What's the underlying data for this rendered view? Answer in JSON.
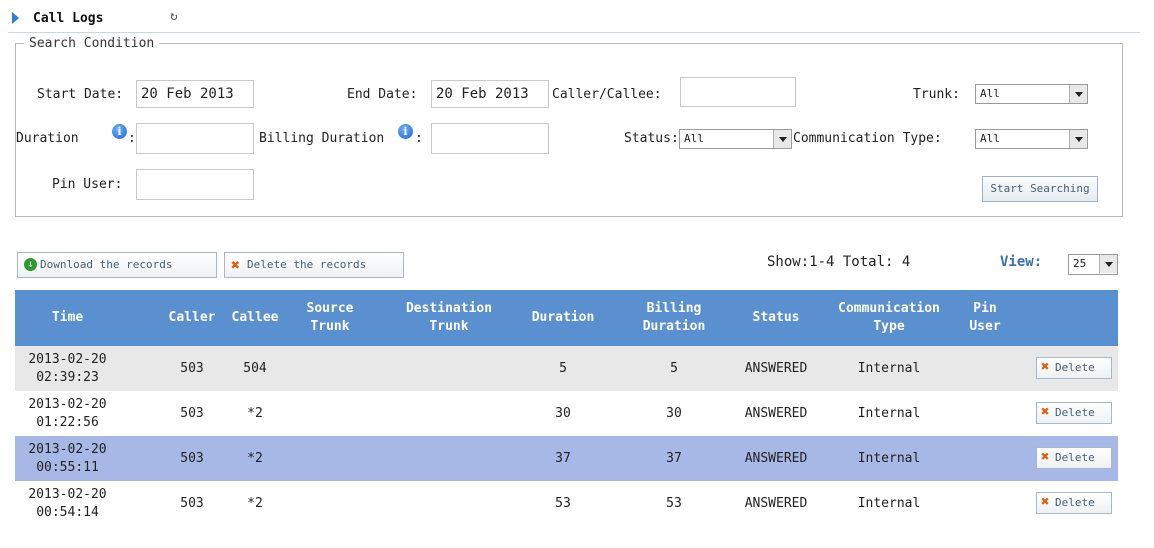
{
  "header": {
    "title": "Call Logs",
    "refresh_icon": "refresh-icon"
  },
  "search": {
    "legend": "Search Condition",
    "start_date_label": "Start Date:",
    "start_date_value": "20 Feb 2013",
    "end_date_label": "End Date:",
    "end_date_value": "20 Feb 2013",
    "caller_callee_label": "Caller/Callee:",
    "caller_callee_value": "",
    "trunk_label": "Trunk:",
    "trunk_value": "All",
    "duration_label": "Duration",
    "duration_colon": ":",
    "duration_value": "",
    "billing_duration_label": "Billing Duration",
    "billing_duration_colon": ":",
    "billing_duration_value": "",
    "status_label": "Status:",
    "status_value": "All",
    "communication_type_label": "Communication Type:",
    "communication_type_value": "All",
    "pin_user_label": "Pin User:",
    "pin_user_value": "",
    "start_button": "Start Searching"
  },
  "actions": {
    "download_label": "Download the records",
    "delete_label": "Delete the records",
    "show_total": "Show:1-4 Total: 4",
    "view_label": "View:",
    "view_value": "25"
  },
  "table": {
    "columns": [
      {
        "l1": "Time",
        "l2": ""
      },
      {
        "l1": "Caller",
        "l2": ""
      },
      {
        "l1": "Callee",
        "l2": ""
      },
      {
        "l1": "Source",
        "l2": "Trunk"
      },
      {
        "l1": "Destination",
        "l2": "Trunk"
      },
      {
        "l1": "Duration",
        "l2": ""
      },
      {
        "l1": "Billing",
        "l2": "Duration"
      },
      {
        "l1": "Status",
        "l2": ""
      },
      {
        "l1": "Communication",
        "l2": "Type"
      },
      {
        "l1": "Pin",
        "l2": "User"
      }
    ],
    "delete_label": "Delete",
    "rows": [
      {
        "date": "2013-02-20",
        "time": "02:39:23",
        "caller": "503",
        "callee": "504",
        "source_trunk": "",
        "destination_trunk": "",
        "duration": "5",
        "billing_duration": "5",
        "status": "ANSWERED",
        "communication_type": "Internal",
        "pin_user": ""
      },
      {
        "date": "2013-02-20",
        "time": "01:22:56",
        "caller": "503",
        "callee": "*2",
        "source_trunk": "",
        "destination_trunk": "",
        "duration": "30",
        "billing_duration": "30",
        "status": "ANSWERED",
        "communication_type": "Internal",
        "pin_user": ""
      },
      {
        "date": "2013-02-20",
        "time": "00:55:11",
        "caller": "503",
        "callee": "*2",
        "source_trunk": "",
        "destination_trunk": "",
        "duration": "37",
        "billing_duration": "37",
        "status": "ANSWERED",
        "communication_type": "Internal",
        "pin_user": ""
      },
      {
        "date": "2013-02-20",
        "time": "00:54:14",
        "caller": "503",
        "callee": "*2",
        "source_trunk": "",
        "destination_trunk": "",
        "duration": "53",
        "billing_duration": "53",
        "status": "ANSWERED",
        "communication_type": "Internal",
        "pin_user": ""
      }
    ]
  },
  "colors": {
    "header_bg": "#5a8fd0",
    "row_even": "#e8e8e8",
    "row_odd": "#ffffff",
    "row_selected": "#a8b8e6"
  }
}
